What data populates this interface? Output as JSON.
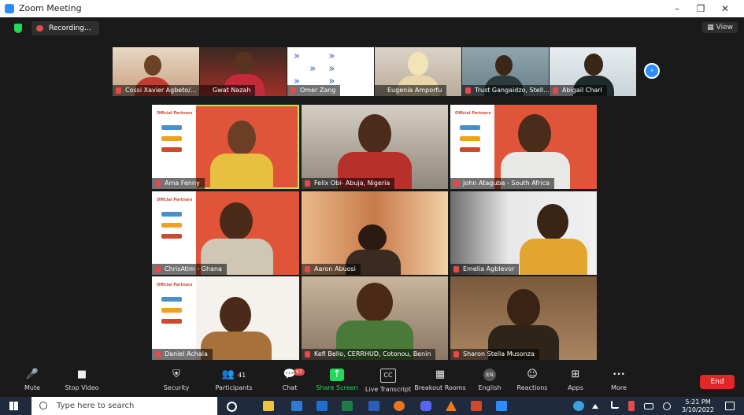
{
  "window": {
    "title": "Zoom Meeting",
    "minimize": "–",
    "restore": "❐",
    "close": "✕"
  },
  "meeting": {
    "recording_label": "Recording...",
    "view_label": "View"
  },
  "strip": {
    "participants": [
      {
        "name": "Cossi Xavier Agbeto/..."
      },
      {
        "name": "Gwat Nazah"
      },
      {
        "name": "Omer Zang"
      },
      {
        "name": "Eugenia Amporfu"
      },
      {
        "name": "Trust Gangaidzo, Stell..."
      },
      {
        "name": "Abigail Chari"
      }
    ],
    "next_icon": "›"
  },
  "grid": {
    "participants": [
      {
        "name": "Ama Fenny"
      },
      {
        "name": "Felix Obi- Abuja, Nigeria"
      },
      {
        "name": "John Ataguba - South Africa"
      },
      {
        "name": "ChrisAtim - Ghana"
      },
      {
        "name": "Aaron Abuosi"
      },
      {
        "name": "Emelia Agblevor"
      },
      {
        "name": "Daniel Achala"
      },
      {
        "name": "Kefi Bello, CERRHUD, Cotonou, Benin"
      },
      {
        "name": "Sharon Stella Musonza"
      }
    ],
    "partners_header": "Official Partners"
  },
  "toolbar": {
    "mute": {
      "label": "Mute",
      "icon": "🎤"
    },
    "video": {
      "label": "Stop Video",
      "icon": "■"
    },
    "security": {
      "label": "Security",
      "icon": "⛨"
    },
    "participants": {
      "label": "Participants",
      "icon": "👥",
      "count": "41"
    },
    "chat": {
      "label": "Chat",
      "icon": "💬",
      "badge": "87"
    },
    "share": {
      "label": "Share Screen",
      "icon": "↑"
    },
    "transcript": {
      "label": "Live Transcript",
      "icon": "CC"
    },
    "breakout": {
      "label": "Breakout Rooms",
      "icon": "▦"
    },
    "language": {
      "label": "English",
      "icon": "EN"
    },
    "reactions": {
      "label": "Reactions",
      "icon": "☺"
    },
    "apps": {
      "label": "Apps",
      "icon": "⊞"
    },
    "more": {
      "label": "More",
      "icon": "•••"
    },
    "end": {
      "label": "End"
    }
  },
  "taskbar": {
    "search_placeholder": "Type here to search",
    "time": "5:21 PM",
    "date": "3/10/2022"
  },
  "colors": {
    "accent": "#2d8cff",
    "share_green": "#23d959",
    "end_red": "#e02828",
    "active_speaker": "#c6e34f"
  }
}
